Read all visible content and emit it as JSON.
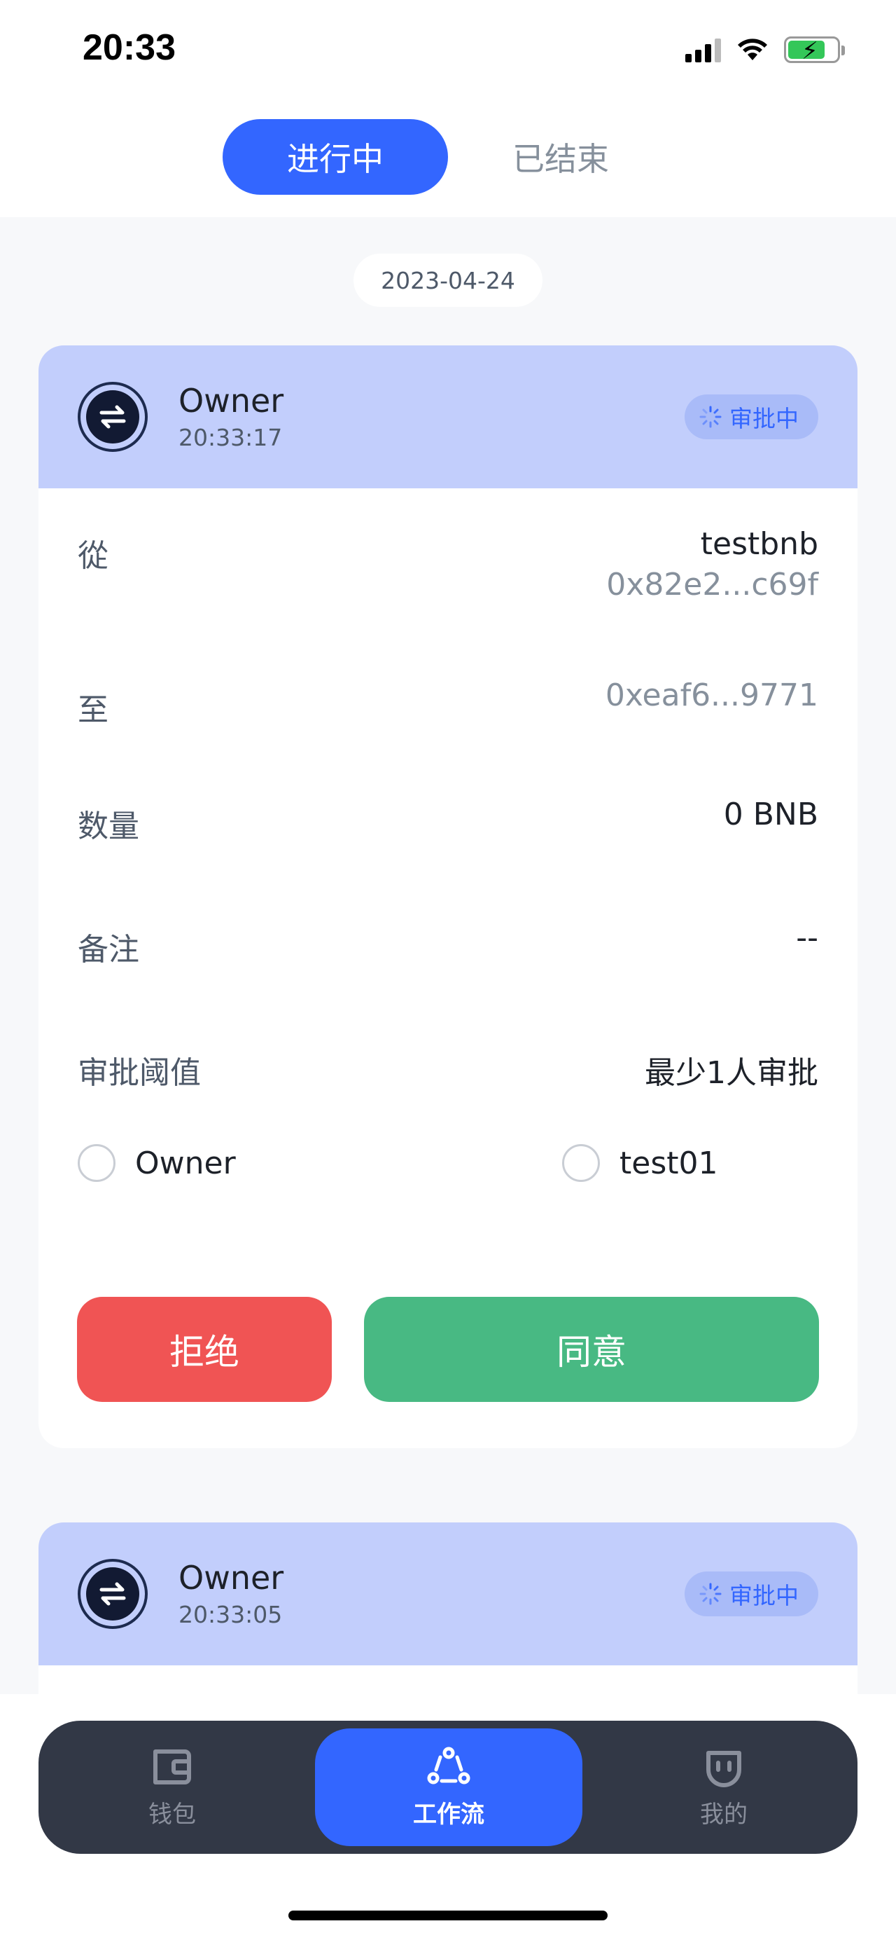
{
  "status_bar": {
    "time": "20:33"
  },
  "tabs": [
    {
      "label": "进行中",
      "active": true
    },
    {
      "label": "已结束",
      "active": false
    }
  ],
  "date_group": "2023-04-24",
  "cards": [
    {
      "title": "Owner",
      "time": "20:33:17",
      "status": "审批中",
      "rows": {
        "from_label": "從",
        "from_name": "testbnb",
        "from_address": "0x82e2...c69f",
        "to_label": "至",
        "to_address": "0xeaf6...9771",
        "amount_label": "数量",
        "amount_value": "0 BNB",
        "note_label": "备注",
        "note_value": "--",
        "threshold_label": "审批阈值",
        "threshold_value": "最少1人审批"
      },
      "approvers": [
        "Owner",
        "test01"
      ],
      "reject_label": "拒绝",
      "approve_label": "同意"
    },
    {
      "title": "Owner",
      "time": "20:33:05",
      "status": "审批中"
    }
  ],
  "bottom_nav": [
    {
      "label": "钱包",
      "icon": "wallet-icon",
      "active": false
    },
    {
      "label": "工作流",
      "icon": "workflow-icon",
      "active": true
    },
    {
      "label": "我的",
      "icon": "profile-icon",
      "active": false
    }
  ],
  "colors": {
    "primary": "#3366ff",
    "reject": "#f05454",
    "approve": "#48b983",
    "card_header": "#c2cefc"
  }
}
